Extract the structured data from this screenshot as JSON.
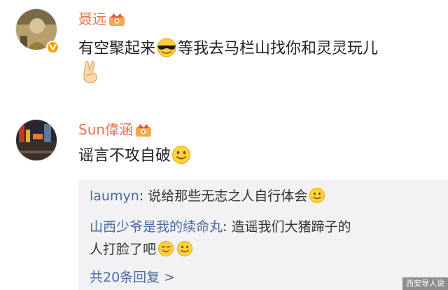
{
  "comments": [
    {
      "username": "聂远",
      "text_main": "有空聚起来",
      "text_after": "等我去马栏山找你和灵灵玩儿",
      "emoji_1": "cool-sunglasses-emoji",
      "emoji_2": "victory-hand-emoji",
      "verified_badge": "orange-v-badge"
    },
    {
      "username": "Sun偉涵",
      "text_main": "谣言不攻自破",
      "emoji_1": "smile-emoji"
    }
  ],
  "replies": {
    "items": [
      {
        "name": "laumyn",
        "separator": ": ",
        "text": "说给那些无志之人自行体会"
      },
      {
        "name": "山西少爷是我的续命丸",
        "separator": ": ",
        "text": "造谣我们大猪蹄子的",
        "text_line2": "人打脸了吧"
      }
    ],
    "more_label": "共20条回复 >"
  },
  "watermark": "西安导人说",
  "colors": {
    "username": "#eb7350",
    "reply_name": "#4a6aa1",
    "reply_bg": "#f2f2f5",
    "badge": "#f5a200"
  }
}
